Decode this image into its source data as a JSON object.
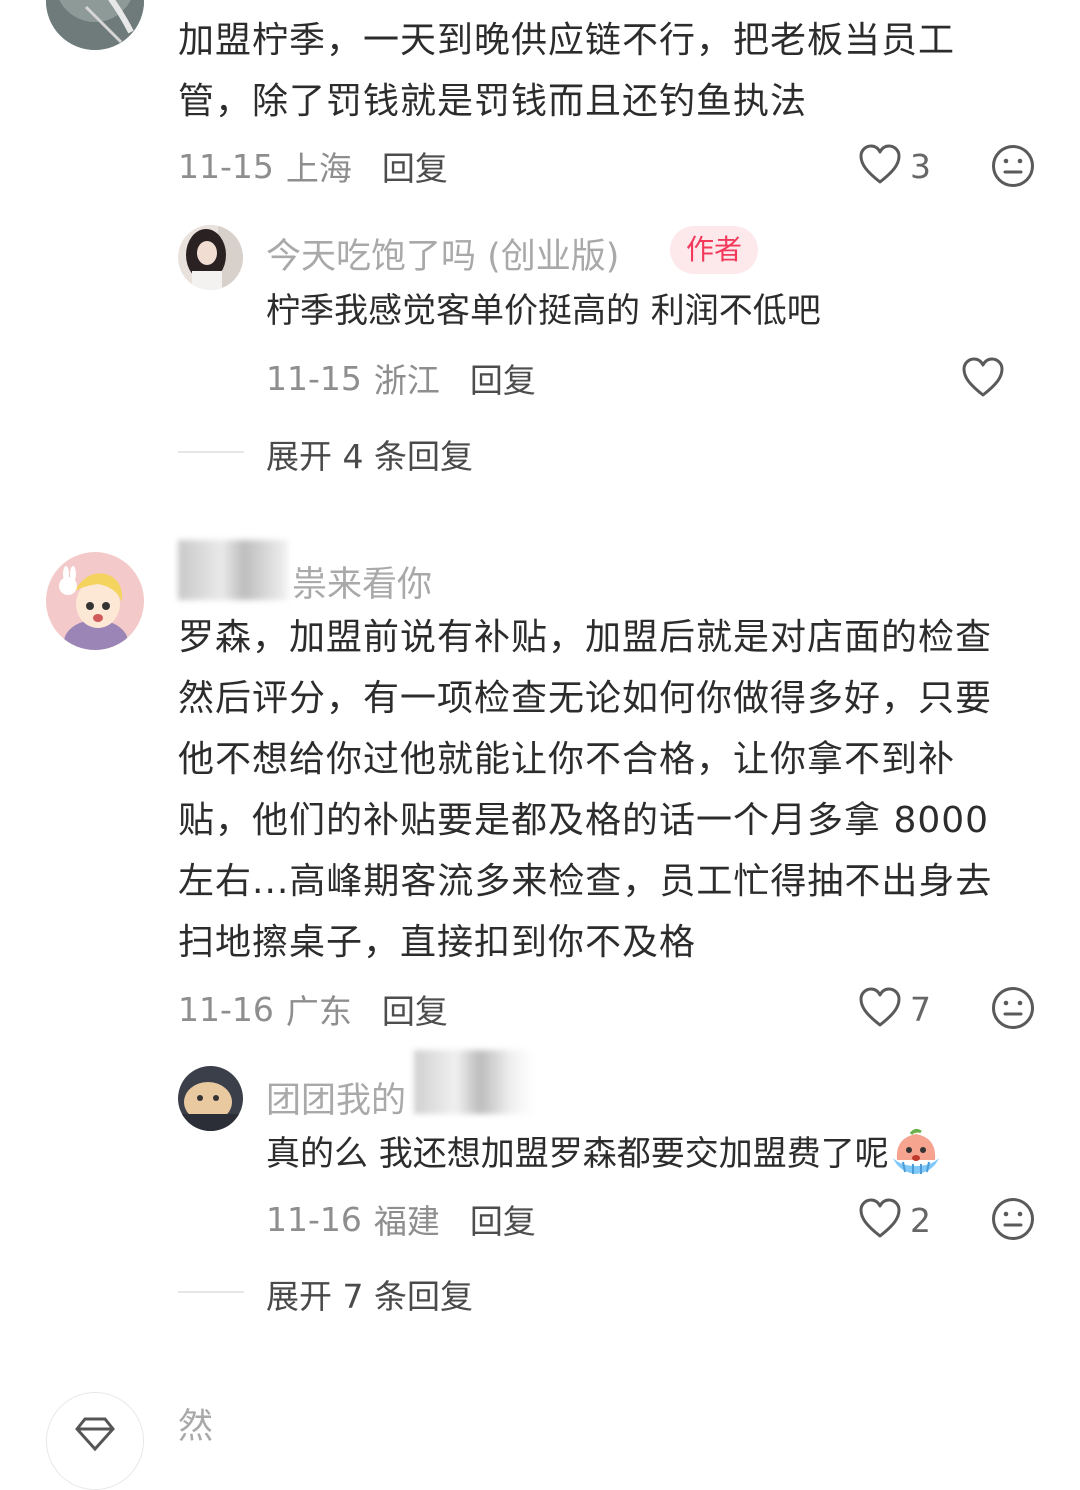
{
  "comments": [
    {
      "lines": [
        "加盟柠季，一天到晚供应链不行，把老板当员工",
        "管，除了罚钱就是罚钱而且还钓鱼执法"
      ],
      "date": "11-15",
      "location": "上海",
      "reply_label": "回复",
      "likes": "3",
      "replies": [
        {
          "username": "今天吃饱了吗 (创业版)",
          "badge": "作者",
          "text": "柠季我感觉客单价挺高的 利润不低吧",
          "date": "11-15",
          "location": "浙江",
          "reply_label": "回复"
        }
      ],
      "expand_label": "展开 4 条回复"
    },
    {
      "username_visible": "祟来看你",
      "lines": [
        "罗森，加盟前说有补贴，加盟后就是对店面的检查",
        "然后评分，有一项检查无论如何你做得多好，只要",
        "他不想给你过他就能让你不合格，让你拿不到补",
        "贴，他们的补贴要是都及格的话一个月多拿 8000",
        "左右...高峰期客流多来检查，员工忙得抽不出身去",
        "扫地擦桌子，直接扣到你不及格"
      ],
      "date": "11-16",
      "location": "广东",
      "reply_label": "回复",
      "likes": "7",
      "replies": [
        {
          "username_visible": "团团我的",
          "text": "真的么 我还想加盟罗森都要交加盟费了呢",
          "date": "11-16",
          "location": "福建",
          "reply_label": "回复",
          "likes": "2"
        }
      ],
      "expand_label": "展开 7 条回复"
    },
    {
      "username_visible": "然"
    }
  ],
  "icons": {
    "like": "heart-outline-icon",
    "dislike": "neutral-face-icon",
    "emoji": "crying-face-emoji"
  },
  "colors": {
    "badge_bg": "#fde8ec",
    "badge_text": "#f2395a"
  }
}
